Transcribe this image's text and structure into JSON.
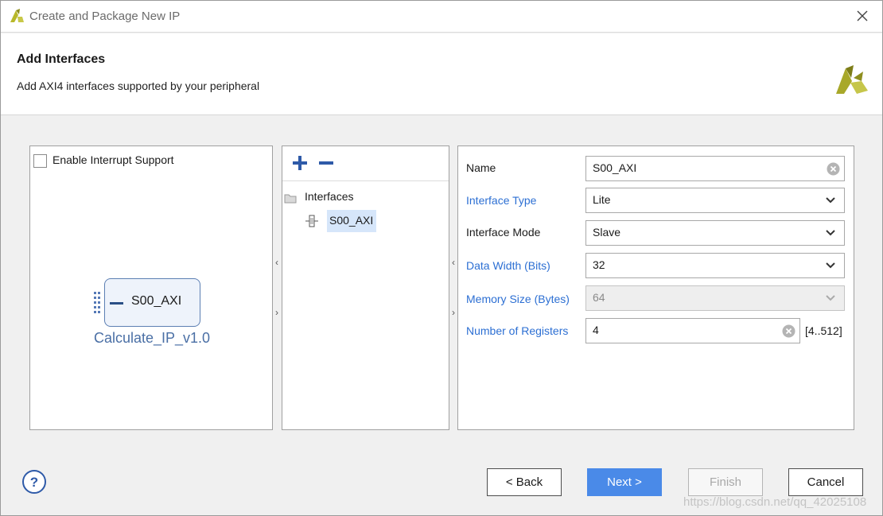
{
  "window": {
    "title": "Create and Package New IP"
  },
  "header": {
    "title": "Add Interfaces",
    "subtitle": "Add AXI4 interfaces supported by your peripheral"
  },
  "left_panel": {
    "checkbox_label": "Enable Interrupt Support",
    "checkbox_checked": false,
    "block_label": "S00_AXI",
    "ip_name": "Calculate_IP_v1.0"
  },
  "tree": {
    "root_label": "Interfaces",
    "items": [
      "S00_AXI"
    ]
  },
  "form": {
    "name": {
      "label": "Name",
      "value": "S00_AXI"
    },
    "interface_type": {
      "label": "Interface Type",
      "value": "Lite"
    },
    "interface_mode": {
      "label": "Interface Mode",
      "value": "Slave"
    },
    "data_width": {
      "label": "Data Width (Bits)",
      "value": "32"
    },
    "memory_size": {
      "label": "Memory Size (Bytes)",
      "value": "64"
    },
    "num_registers": {
      "label": "Number of Registers",
      "value": "4",
      "range": "[4..512]"
    }
  },
  "footer": {
    "back_label": "< Back",
    "next_label": "Next >",
    "finish_label": "Finish",
    "cancel_label": "Cancel"
  },
  "watermark": "https://blog.csdn.net/qq_42025108",
  "colors": {
    "accent": "#4a8ae8",
    "link_label": "#2c6fd3",
    "selection": "#d6e6fa",
    "logo": "#b5b52a"
  }
}
